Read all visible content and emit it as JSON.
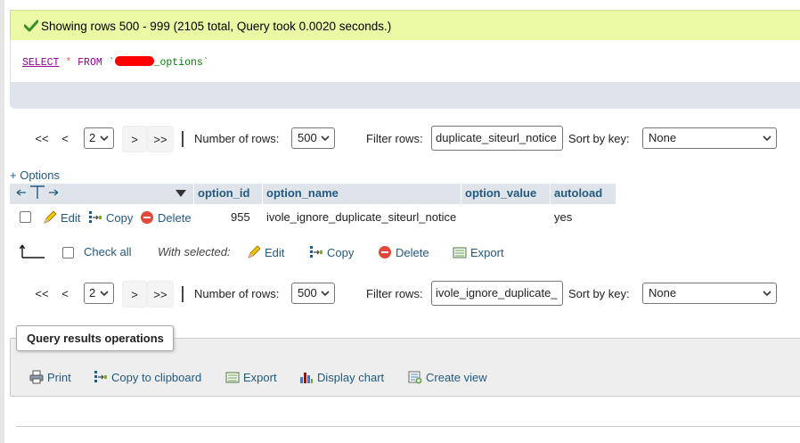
{
  "success": {
    "icon": "check-icon",
    "message": "Showing rows 500 - 999 (2105 total, Query took 0.0020 seconds.)"
  },
  "sql": {
    "select": "SELECT",
    "star": "*",
    "from": "FROM",
    "table_prefix": "`",
    "table_suffix": "_options`"
  },
  "nav_top": {
    "first": "<<",
    "prev": "<",
    "page": "2",
    "next": ">",
    "last": ">>",
    "rows_label": "Number of rows:",
    "rows_value": "500",
    "filter_label": "Filter rows:",
    "filter_value": "duplicate_siteurl_notice",
    "sort_label": "Sort by key:",
    "sort_value": "None"
  },
  "nav_bottom": {
    "first": "<<",
    "prev": "<",
    "page": "2",
    "next": ">",
    "last": ">>",
    "rows_label": "Number of rows:",
    "rows_value": "500",
    "filter_label": "Filter rows:",
    "filter_value": "ivole_ignore_duplicate_",
    "sort_label": "Sort by key:",
    "sort_value": "None"
  },
  "options_link": "+ Options",
  "table": {
    "columns": [
      "option_id",
      "option_name",
      "option_value",
      "autoload"
    ],
    "rows": [
      {
        "edit": "Edit",
        "copy": "Copy",
        "delete": "Delete",
        "option_id": "955",
        "option_name": "ivole_ignore_duplicate_siteurl_notice",
        "option_value": "",
        "autoload": "yes"
      }
    ]
  },
  "bulk": {
    "check_all": "Check all",
    "with_selected": "With selected:",
    "edit": "Edit",
    "copy": "Copy",
    "delete": "Delete",
    "export": "Export"
  },
  "qro": {
    "title": "Query results operations",
    "print": "Print",
    "copy_clipboard": "Copy to clipboard",
    "export": "Export",
    "display_chart": "Display chart",
    "create_view": "Create view"
  },
  "colors": {
    "success_bg": "#ebf8a4",
    "link": "#235a81",
    "header_bg": "#dfe4ea",
    "redaction": "#ff0000"
  }
}
